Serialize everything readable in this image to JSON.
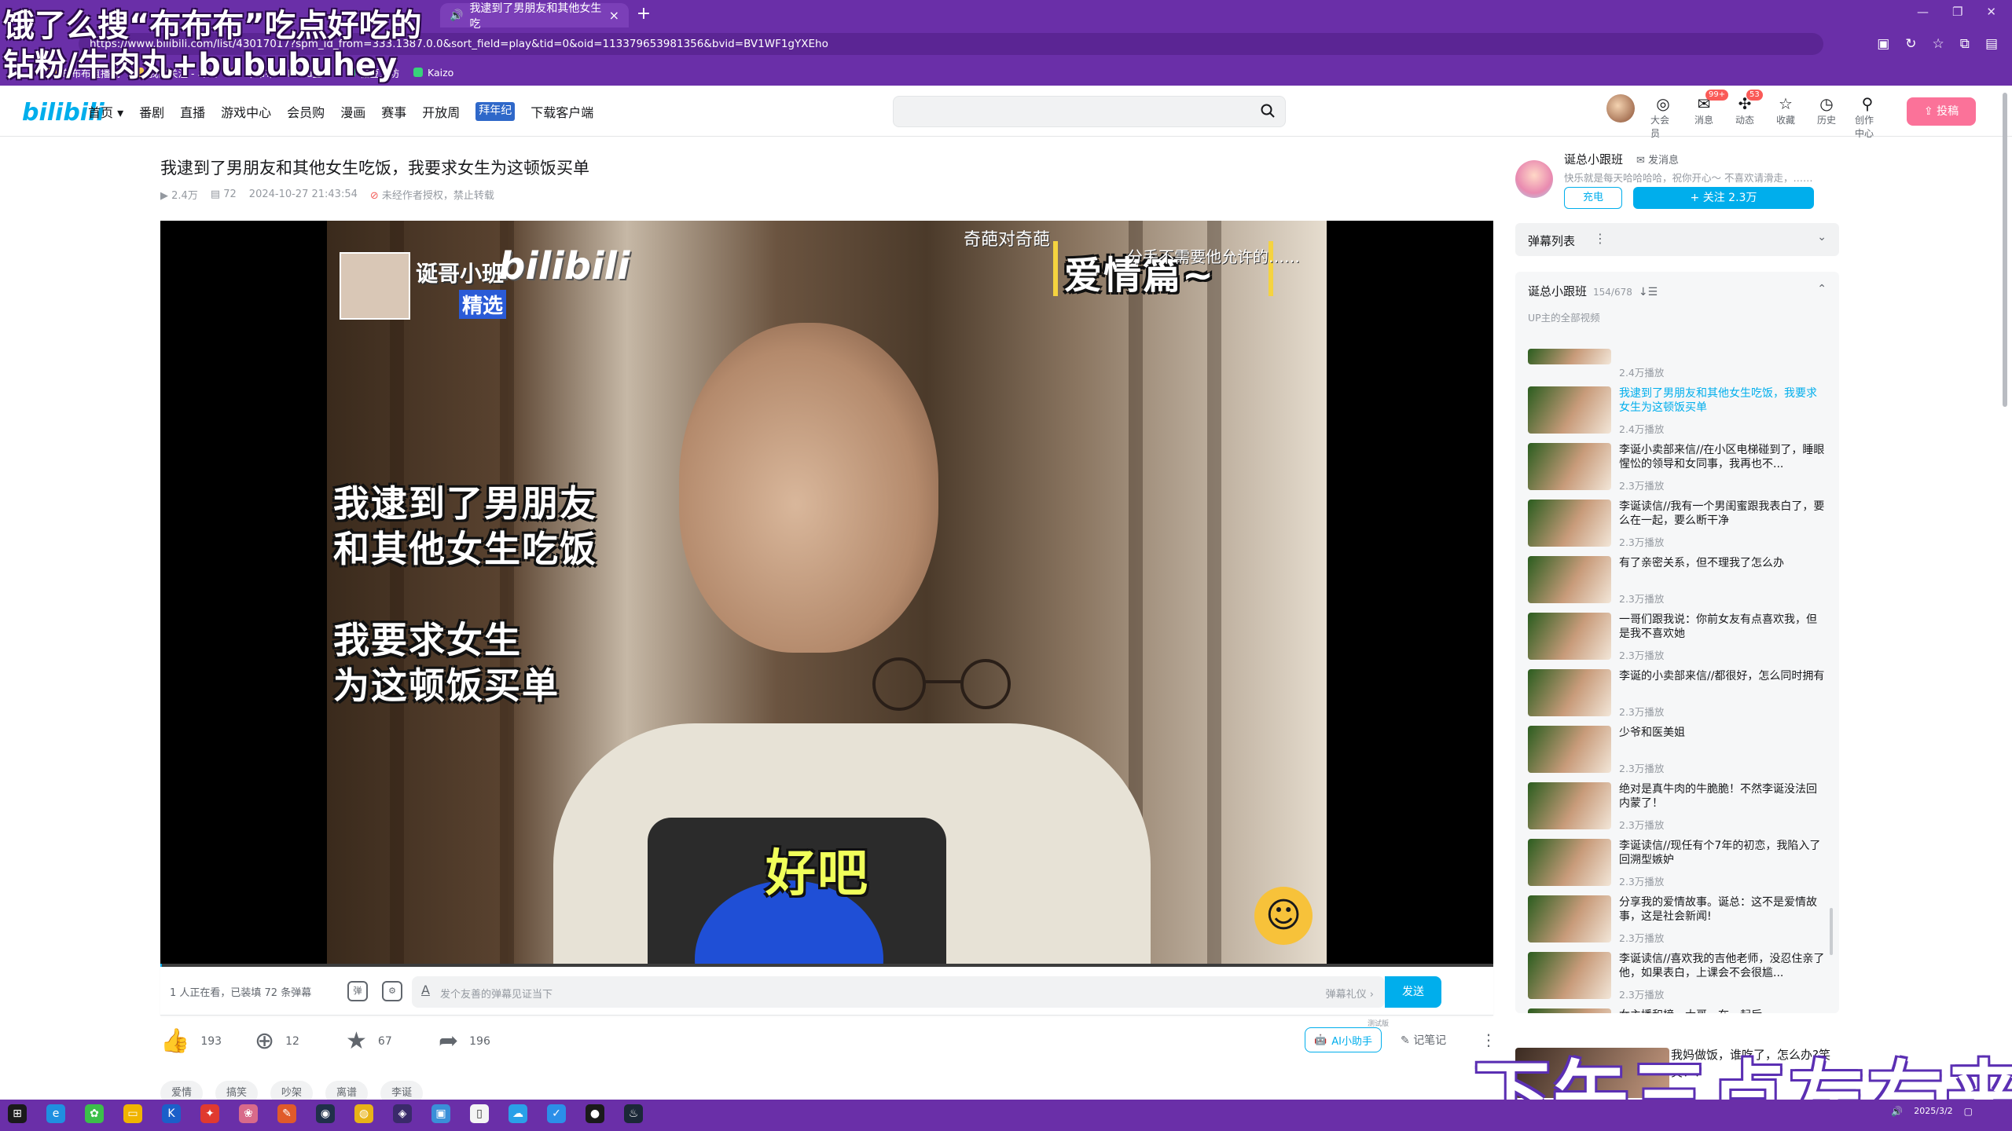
{
  "overlay": {
    "line1": "饿了么搜“布布布”吃点好吃的",
    "line2": "钻粉/牛肉丸+bububuhey",
    "bottom": "下午三点左右来"
  },
  "browser": {
    "active_tab": "我逮到了男朋友和其他女生吃",
    "url": "https://www.bilibili.com/list/43017017?spm_id_from=333.1387.0.0&sort_field=play&tid=0&oid=113379653981356&bvid=BV1WF1gYXEho",
    "bookmarks": [
      "布布布直播间",
      "我的关注 - 斗鱼",
      "布布布bububu直...",
      "糖豆工坊",
      "Kaizo"
    ]
  },
  "header": {
    "logo": "bilibili",
    "nav": [
      "首页 ▾",
      "番剧",
      "直播",
      "游戏中心",
      "会员购",
      "漫画",
      "赛事",
      "开放周",
      "拜年纪",
      "下载客户端"
    ],
    "icons": [
      {
        "label": "大会员",
        "icon": "member-icon",
        "badge": ""
      },
      {
        "label": "消息",
        "icon": "message-icon",
        "badge": "99+"
      },
      {
        "label": "动态",
        "icon": "dynamic-icon",
        "badge": "53"
      },
      {
        "label": "收藏",
        "icon": "favorites-icon",
        "badge": ""
      },
      {
        "label": "历史",
        "icon": "history-icon",
        "badge": ""
      },
      {
        "label": "创作中心",
        "icon": "creator-icon",
        "badge": ""
      }
    ],
    "upload": "投稿"
  },
  "video": {
    "title": "我逮到了男朋友和其他女生吃饭，我要求女生为这顿饭买单",
    "plays": "2.4万",
    "danmaku_count": "72",
    "date": "2024-10-27 21:43:54",
    "copyright": "未经作者授权，禁止转载",
    "progress": 0.001
  },
  "frame": {
    "caption_main": [
      "我逮到了男朋友",
      "和其他女生吃饭",
      "我要求女生",
      "为这顿饭买单"
    ],
    "caption_okay": "好吧",
    "caption_love": "爱情篇~",
    "caption_top": "奇葩对奇葩",
    "caption_small": "分手不需要他允许的……",
    "wm_name": "诞哥小班",
    "wm_logo": "bilibili",
    "wm_select": "精选"
  },
  "danmaku_bar": {
    "viewers": "1 人正在看，已装填 72 条弹幕",
    "placeholder": "发个友善的弹幕见证当下",
    "etiquette": "弹幕礼仪 ›",
    "send": "发送"
  },
  "toolbar": {
    "like": "193",
    "coin": "12",
    "fav": "67",
    "share": "196",
    "ai_tag": "测试版",
    "ai": "AI小助手",
    "notes": "记笔记"
  },
  "tags": [
    "爱情",
    "搞笑",
    "吵架",
    "离谱",
    "李诞"
  ],
  "uploader": {
    "name": "诞总小跟班",
    "message": "发消息",
    "desc": "快乐就是每天哈哈哈哈，祝你开心～ 不喜欢请滑走，……",
    "charge": "充电",
    "follow": "+ 关注 2.3万"
  },
  "danmaku_list": {
    "title": "弹幕列表"
  },
  "playlist": {
    "title": "诞总小跟班",
    "count": "154/678",
    "subtitle": "UP主的全部视频",
    "items": [
      {
        "title": "",
        "views": "2.4万播放"
      },
      {
        "title": "我逮到了男朋友和其他女生吃饭，我要求女生为这顿饭买单",
        "views": "2.4万播放"
      },
      {
        "title": "李诞小卖部来信//在小区电梯碰到了，睡眼惺忪的领导和女同事，我再也不...",
        "views": "2.3万播放"
      },
      {
        "title": "李诞读信//我有一个男闺蜜跟我表白了，要么在一起，要么断干净",
        "views": "2.3万播放"
      },
      {
        "title": "有了亲密关系，但不理我了怎么办",
        "views": "2.3万播放"
      },
      {
        "title": "一哥们跟我说：你前女友有点喜欢我，但是我不喜欢她",
        "views": "2.3万播放"
      },
      {
        "title": "李诞的小卖部来信//都很好，怎么同时拥有",
        "views": "2.3万播放"
      },
      {
        "title": "少爷和医美姐",
        "views": "2.3万播放"
      },
      {
        "title": "绝对是真牛肉的牛脆脆！不然李诞没法回内蒙了！",
        "views": "2.3万播放"
      },
      {
        "title": "李诞读信//现任有个7年的初恋，我陷入了回溯型嫉妒",
        "views": "2.3万播放"
      },
      {
        "title": "分享我的爱情故事。诞总：这不是爱情故事，这是社会新闻!",
        "views": "2.3万播放"
      },
      {
        "title": "李诞读信//喜欢我的吉他老师，没忍住亲了他，如果表白，上课会不会很尴...",
        "views": "2.3万播放"
      },
      {
        "title": "女主播和榜一大哥，在一起后",
        "views": ""
      }
    ]
  },
  "recommend": {
    "title": "我妈做饭，谁吃了，怎么办?笑笑！？"
  },
  "taskbar": {
    "time": "",
    "date": "2025/3/2"
  },
  "colors": {
    "accent": "#00aeec",
    "pink": "#fb7299",
    "chrome": "#6a2fa8"
  }
}
